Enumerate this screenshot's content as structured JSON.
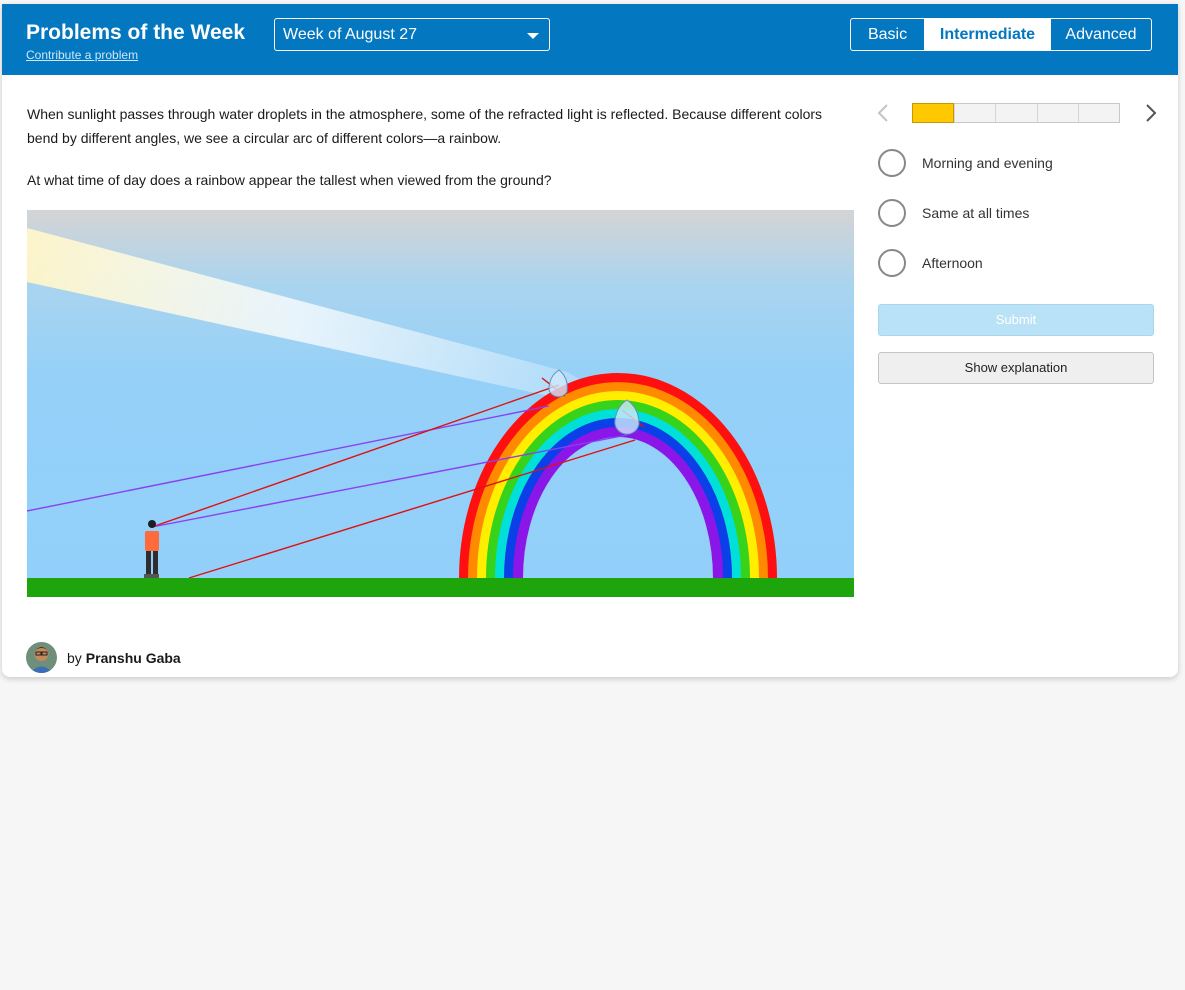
{
  "header": {
    "title": "Problems of the Week",
    "contribute_link": "Contribute a problem",
    "week_select": {
      "selected": "Week of August 27",
      "icon": "chevron-down-icon"
    },
    "levels": [
      {
        "label": "Basic",
        "active": false
      },
      {
        "label": "Intermediate",
        "active": true
      },
      {
        "label": "Advanced",
        "active": false
      }
    ],
    "brand_color": "#0377bf"
  },
  "problem": {
    "paragraphs": [
      "When sunlight passes through water droplets in the atmosphere, some of the refracted light is reflected. Because different colors bend by different angles, we see a circular arc of different colors—a rainbow.",
      "At what time of day does a rainbow appear the tallest when viewed from the ground?"
    ]
  },
  "author": {
    "prefix": "by",
    "name": "Pranshu Gaba"
  },
  "sidebar": {
    "progress": {
      "current": 1,
      "total": 5,
      "active_color": "#ffc800"
    },
    "options": [
      {
        "label": "Morning and evening"
      },
      {
        "label": "Same at all times"
      },
      {
        "label": "Afternoon"
      }
    ],
    "submit_label": "Submit",
    "explain_label": "Show explanation"
  }
}
